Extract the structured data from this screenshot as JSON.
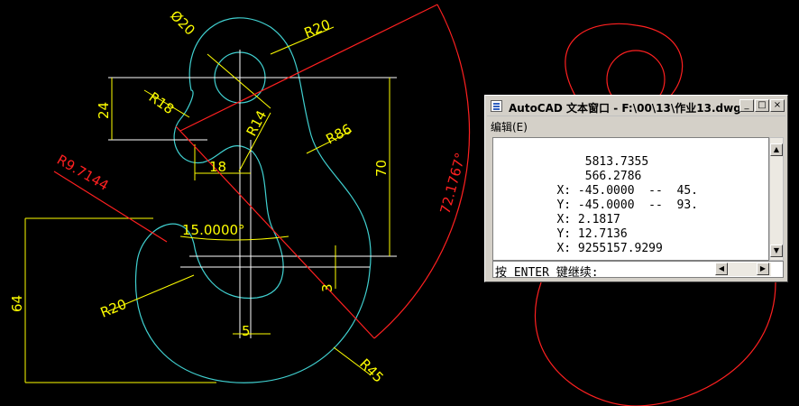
{
  "colors": {
    "background": "#000000",
    "outline": "#40d0d0",
    "dimension": "#ffff00",
    "reference": "#ff2020",
    "centerline": "#ffffff"
  },
  "drawing": {
    "labels": {
      "dia20": "Ø20",
      "r20_top": "R20",
      "r18": "R18",
      "r14": "R14",
      "r86": "R86",
      "r9": "R9.7144",
      "dim24": "24",
      "dim18": "18",
      "dim70": "70",
      "angle15": "15.0000°",
      "dim64": "64",
      "r20_left": "R20",
      "dim3": "3",
      "dim5": "5",
      "r45": "R45",
      "angle72": "72.1767°"
    }
  },
  "text_window": {
    "title": "AutoCAD 文本窗口 - F:\\00\\13\\作业13.dwg",
    "menu_edit": "编辑(E)",
    "lines": [
      "             5813.7355",
      "             566.2786",
      "         X: -45.0000  --  45.",
      "         Y: -45.0000  --  93.",
      "         X: 2.1817",
      "         Y: 12.7136",
      "         X: 9255157.9299"
    ],
    "command_prompt": "按 ENTER 键继续:",
    "buttons": {
      "minimize": "_",
      "maximize": "□",
      "close": "×"
    },
    "scroll_icons": {
      "up": "scroll-up-arrow-icon",
      "down": "scroll-down-arrow-icon",
      "left": "scroll-left-arrow-icon",
      "right": "scroll-right-arrow-icon"
    }
  }
}
